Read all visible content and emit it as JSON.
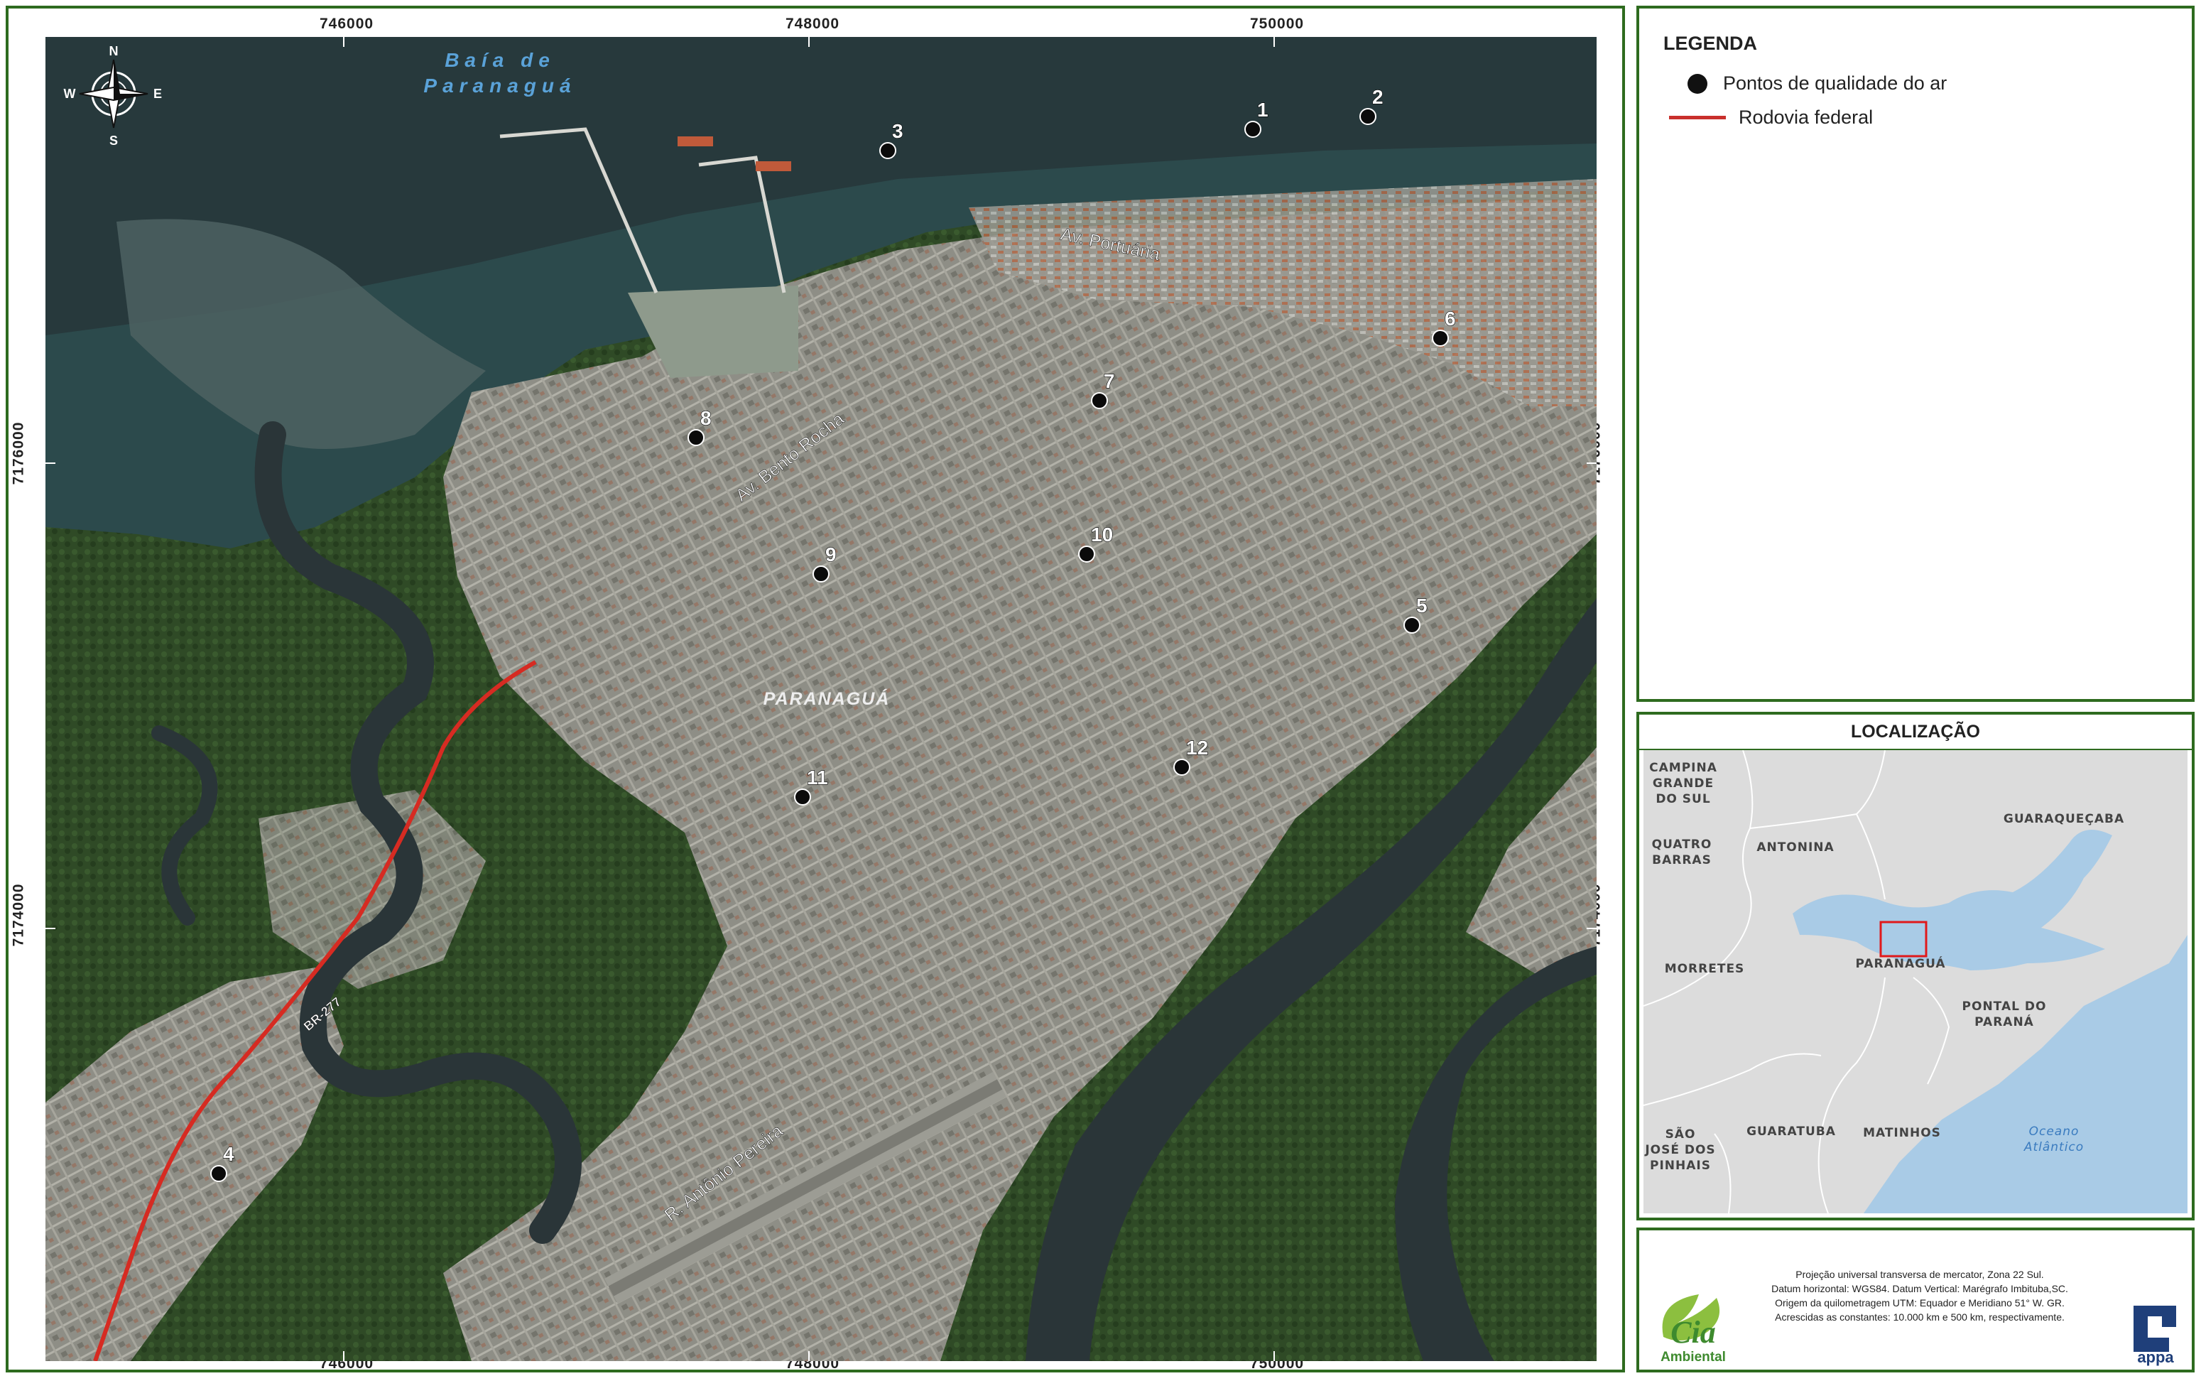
{
  "map": {
    "x_ticks": [
      "746000",
      "748000",
      "750000"
    ],
    "y_ticks": [
      "7176000",
      "7174000"
    ],
    "compass": {
      "n": "N",
      "s": "S",
      "e": "E",
      "w": "W"
    },
    "bay_label": [
      "Baía de",
      "Paranaguá"
    ],
    "city_label": "PARANAGUÁ",
    "roads": {
      "portuaria": "Av. Portuária",
      "bento_rocha": "Av. Bento Rocha",
      "antonio_pereira": "R. Antônio Pereira",
      "br277": "BR-277"
    },
    "points": [
      {
        "label": "1"
      },
      {
        "label": "2"
      },
      {
        "label": "3"
      },
      {
        "label": "4"
      },
      {
        "label": "5"
      },
      {
        "label": "6"
      },
      {
        "label": "7"
      },
      {
        "label": "8"
      },
      {
        "label": "9"
      },
      {
        "label": "10"
      },
      {
        "label": "11"
      },
      {
        "label": "12"
      }
    ],
    "colors": {
      "water": "#2b3a3c",
      "urban": "#8f8f86",
      "forest": "#2f4a26",
      "road": "#d62b22",
      "frame": "#2e6b1f"
    }
  },
  "legend": {
    "title": "LEGENDA",
    "items": [
      {
        "label": "Pontos de qualidade do ar",
        "symbol": "black-dot"
      },
      {
        "label": "Rodovia federal",
        "symbol": "red-line"
      }
    ]
  },
  "location": {
    "title": "LOCALIZAÇÃO",
    "places": {
      "campina": [
        "CAMPINA",
        "GRANDE",
        "DO SUL"
      ],
      "quatro": [
        "QUATRO",
        "BARRAS"
      ],
      "antonina": "ANTONINA",
      "guaraquecaba": "GUARAQUEÇABA",
      "morretes": "MORRETES",
      "paranagua": "PARANAGUÁ",
      "pontal": [
        "PONTAL DO",
        "PARANÁ"
      ],
      "sao_jose": [
        "SÃO",
        "JOSÉ DOS",
        "PINHAIS"
      ],
      "guaratuba": "GUARATUBA",
      "matinhos": "MATINHOS",
      "oceano": [
        "Oceano",
        "Atlântico"
      ]
    }
  },
  "info": {
    "lines": [
      "Projeção universal transversa de mercator, Zona 22 Sul.",
      "Datum horizontal:  WGS84. Datum Vertical: Marégrafo Imbituba,SC.",
      "Origem da quilometragem UTM: Equador e Meridiano 51° W. GR.",
      "Acrescidas as constantes: 10.000 km e 500 km, respectivamente."
    ],
    "logo_left": [
      "Cia",
      "Ambiental"
    ],
    "logo_right": "appa"
  }
}
